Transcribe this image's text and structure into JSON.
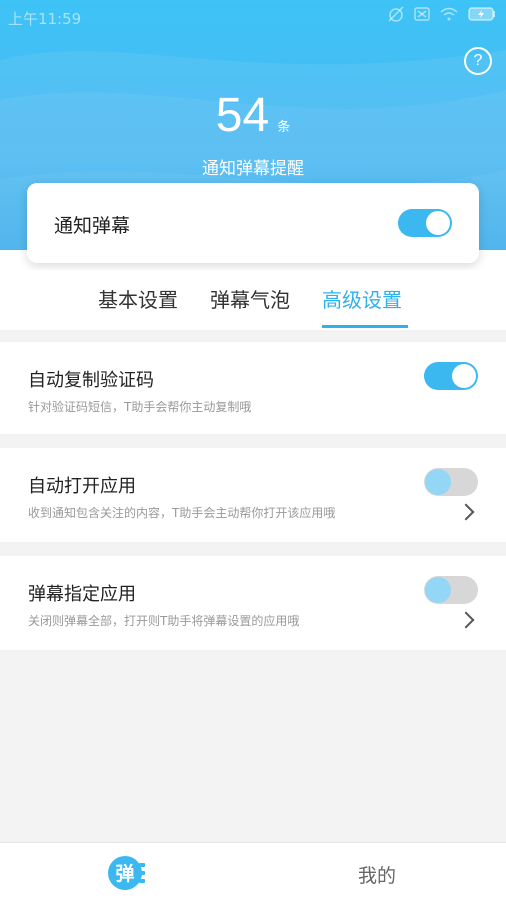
{
  "status_bar": {
    "time": "上午11:59"
  },
  "header": {
    "count": "54",
    "count_unit": "条",
    "subtitle": "通知弹幕提醒",
    "help_symbol": "?"
  },
  "notification_card": {
    "label": "通知弹幕",
    "enabled": true
  },
  "tabs": [
    {
      "label": "基本设置",
      "active": false
    },
    {
      "label": "弹幕气泡",
      "active": false
    },
    {
      "label": "高级设置",
      "active": true
    }
  ],
  "settings": [
    {
      "title": "自动复制验证码",
      "desc": "针对验证码短信，T助手会帮你主动复制哦",
      "enabled": true,
      "has_chevron": false
    },
    {
      "title": "自动打开应用",
      "desc": "收到通知包含关注的内容，T助手会主动帮你打开该应用哦",
      "enabled": false,
      "has_chevron": true
    },
    {
      "title": "弹幕指定应用",
      "desc": "关闭则弹幕全部，打开则T助手将弹幕设置的应用哦",
      "enabled": false,
      "has_chevron": true
    }
  ],
  "bottom_nav": {
    "home_icon_char": "弹",
    "mine_label": "我的"
  },
  "colors": {
    "accent": "#2fb1ec",
    "header_blue": "#3ec3f6",
    "toggle_off": "#d7d7d7"
  }
}
